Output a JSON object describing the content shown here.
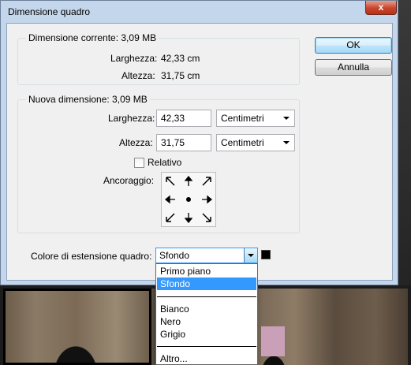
{
  "dialog": {
    "title": "Dimensione quadro",
    "close_label": "x",
    "current": {
      "legend": "Dimensione corrente: 3,09 MB",
      "width_label": "Larghezza:",
      "width_value": "42,33 cm",
      "height_label": "Altezza:",
      "height_value": "31,75 cm"
    },
    "new": {
      "legend": "Nuova dimensione: 3,09 MB",
      "width_label": "Larghezza:",
      "width_value": "42,33",
      "width_unit": "Centimetri",
      "height_label": "Altezza:",
      "height_value": "31,75",
      "height_unit": "Centimetri",
      "relative_label": "Relativo",
      "relative_checked": false,
      "anchor_label": "Ancoraggio:"
    },
    "extension_color": {
      "label": "Colore di estensione quadro:",
      "selected": "Sfondo",
      "swatch_color": "#000000",
      "options": [
        "Primo piano",
        "Sfondo",
        "Bianco",
        "Nero",
        "Grigio",
        "Altro..."
      ]
    },
    "buttons": {
      "ok": "OK",
      "cancel": "Annulla"
    }
  },
  "colors": {
    "titlebar": "#c3d6ec",
    "selection": "#3399ff",
    "close": "#c7452d"
  }
}
